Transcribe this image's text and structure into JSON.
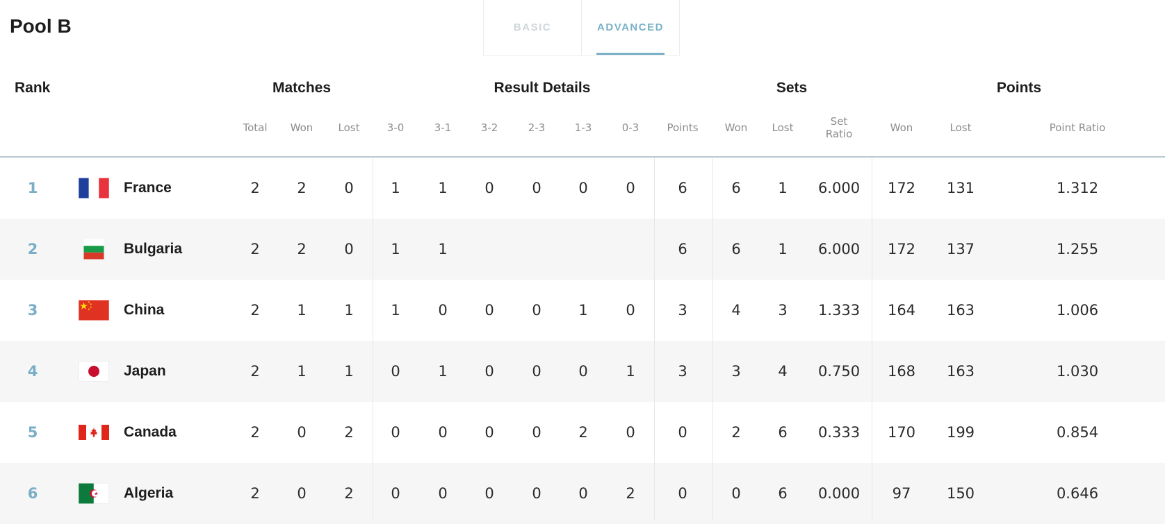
{
  "pool_title": "Pool B",
  "tabs": {
    "basic": "BASIC",
    "advanced": "ADVANCED",
    "active": "ADVANCED"
  },
  "headers": {
    "rank": "Rank",
    "matches": "Matches",
    "result_details": "Result Details",
    "sets": "Sets",
    "points": "Points"
  },
  "sub_headers": {
    "total": "Total",
    "won": "Won",
    "lost": "Lost",
    "r30": "3-0",
    "r31": "3-1",
    "r32": "3-2",
    "r23": "2-3",
    "r13": "1-3",
    "r03": "0-3",
    "points": "Points",
    "sets_won": "Won",
    "sets_lost": "Lost",
    "set_ratio": "Set Ratio",
    "points_won": "Won",
    "points_lost": "Lost",
    "point_ratio": "Point Ratio"
  },
  "colors": {
    "accent": "#7ab1c8",
    "row_alt": "#f6f6f6",
    "rule": "#b9c8cf"
  },
  "rows": [
    {
      "rank": "1",
      "team": "France",
      "flag": "flag-france",
      "total": "2",
      "won": "2",
      "lost": "0",
      "r30": "1",
      "r31": "1",
      "r32": "0",
      "r23": "0",
      "r13": "0",
      "r03": "0",
      "points": "6",
      "sets_won": "6",
      "sets_lost": "1",
      "set_ratio": "6.000",
      "points_won": "172",
      "points_lost": "131",
      "point_ratio": "1.312"
    },
    {
      "rank": "2",
      "team": "Bulgaria",
      "flag": "flag-bulgaria",
      "total": "2",
      "won": "2",
      "lost": "0",
      "r30": "1",
      "r31": "1",
      "r32": "",
      "r23": "",
      "r13": "",
      "r03": "",
      "points": "6",
      "sets_won": "6",
      "sets_lost": "1",
      "set_ratio": "6.000",
      "points_won": "172",
      "points_lost": "137",
      "point_ratio": "1.255"
    },
    {
      "rank": "3",
      "team": "China",
      "flag": "flag-china",
      "total": "2",
      "won": "1",
      "lost": "1",
      "r30": "1",
      "r31": "0",
      "r32": "0",
      "r23": "0",
      "r13": "1",
      "r03": "0",
      "points": "3",
      "sets_won": "4",
      "sets_lost": "3",
      "set_ratio": "1.333",
      "points_won": "164",
      "points_lost": "163",
      "point_ratio": "1.006"
    },
    {
      "rank": "4",
      "team": "Japan",
      "flag": "flag-japan",
      "total": "2",
      "won": "1",
      "lost": "1",
      "r30": "0",
      "r31": "1",
      "r32": "0",
      "r23": "0",
      "r13": "0",
      "r03": "1",
      "points": "3",
      "sets_won": "3",
      "sets_lost": "4",
      "set_ratio": "0.750",
      "points_won": "168",
      "points_lost": "163",
      "point_ratio": "1.030"
    },
    {
      "rank": "5",
      "team": "Canada",
      "flag": "flag-canada",
      "total": "2",
      "won": "0",
      "lost": "2",
      "r30": "0",
      "r31": "0",
      "r32": "0",
      "r23": "0",
      "r13": "2",
      "r03": "0",
      "points": "0",
      "sets_won": "2",
      "sets_lost": "6",
      "set_ratio": "0.333",
      "points_won": "170",
      "points_lost": "199",
      "point_ratio": "0.854"
    },
    {
      "rank": "6",
      "team": "Algeria",
      "flag": "flag-algeria",
      "total": "2",
      "won": "0",
      "lost": "2",
      "r30": "0",
      "r31": "0",
      "r32": "0",
      "r23": "0",
      "r13": "0",
      "r03": "2",
      "points": "0",
      "sets_won": "0",
      "sets_lost": "6",
      "set_ratio": "0.000",
      "points_won": "97",
      "points_lost": "150",
      "point_ratio": "0.646"
    }
  ]
}
